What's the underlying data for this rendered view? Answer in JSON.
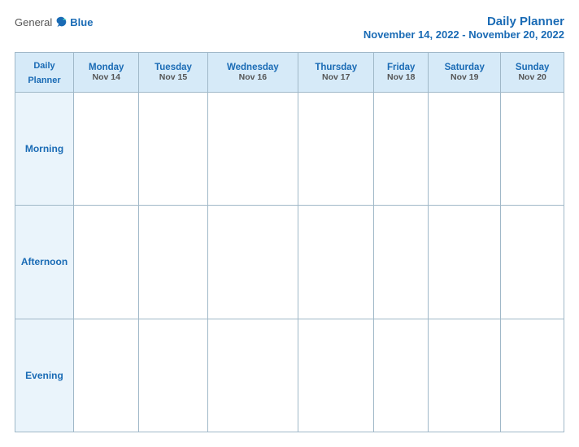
{
  "header": {
    "logo_general": "General",
    "logo_blue": "Blue",
    "title": "Daily Planner",
    "date_range": "November 14, 2022 - November 20, 2022"
  },
  "table": {
    "header_col": {
      "line1": "Daily",
      "line2": "Planner"
    },
    "days": [
      {
        "name": "Monday",
        "date": "Nov 14"
      },
      {
        "name": "Tuesday",
        "date": "Nov 15"
      },
      {
        "name": "Wednesday",
        "date": "Nov 16"
      },
      {
        "name": "Thursday",
        "date": "Nov 17"
      },
      {
        "name": "Friday",
        "date": "Nov 18"
      },
      {
        "name": "Saturday",
        "date": "Nov 19"
      },
      {
        "name": "Sunday",
        "date": "Nov 20"
      }
    ],
    "time_slots": [
      "Morning",
      "Afternoon",
      "Evening"
    ]
  }
}
